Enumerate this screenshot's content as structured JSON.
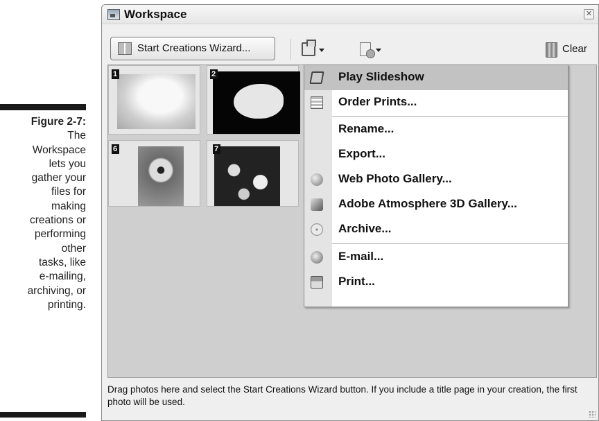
{
  "caption": {
    "label": "Figure 2-7:",
    "text": "The\nWorkspace\nlets you\ngather your\nfiles for\nmaking\ncreations or\nperforming\nother\ntasks, like\ne-mailing,\narchiving, or\nprinting."
  },
  "window": {
    "title": "Workspace",
    "close_glyph": "✕"
  },
  "toolbar": {
    "wizard_label": "Start Creations Wizard...",
    "clear_label": "Clear"
  },
  "thumbnails": [
    {
      "number": "1"
    },
    {
      "number": "2"
    },
    {
      "number": "6"
    },
    {
      "number": "7"
    }
  ],
  "menu": {
    "items": [
      {
        "label": "Play Slideshow",
        "icon": "slideshow-icon",
        "highlighted": true
      },
      {
        "label": "Order Prints...",
        "icon": "order-prints-icon"
      },
      {
        "label": "Rename...",
        "icon": ""
      },
      {
        "label": "Export...",
        "icon": ""
      },
      {
        "label": "Web Photo Gallery...",
        "icon": "web-gallery-icon"
      },
      {
        "label": "Adobe Atmosphere 3D Gallery...",
        "icon": "3d-gallery-icon"
      },
      {
        "label": "Archive...",
        "icon": "archive-disc-icon"
      },
      {
        "label": "E-mail...",
        "icon": "email-icon"
      },
      {
        "label": "Print...",
        "icon": "printer-icon"
      }
    ]
  },
  "status": {
    "text": "Drag photos here and select the Start Creations Wizard button. If you include a title page in your creation, the first photo will be used."
  }
}
